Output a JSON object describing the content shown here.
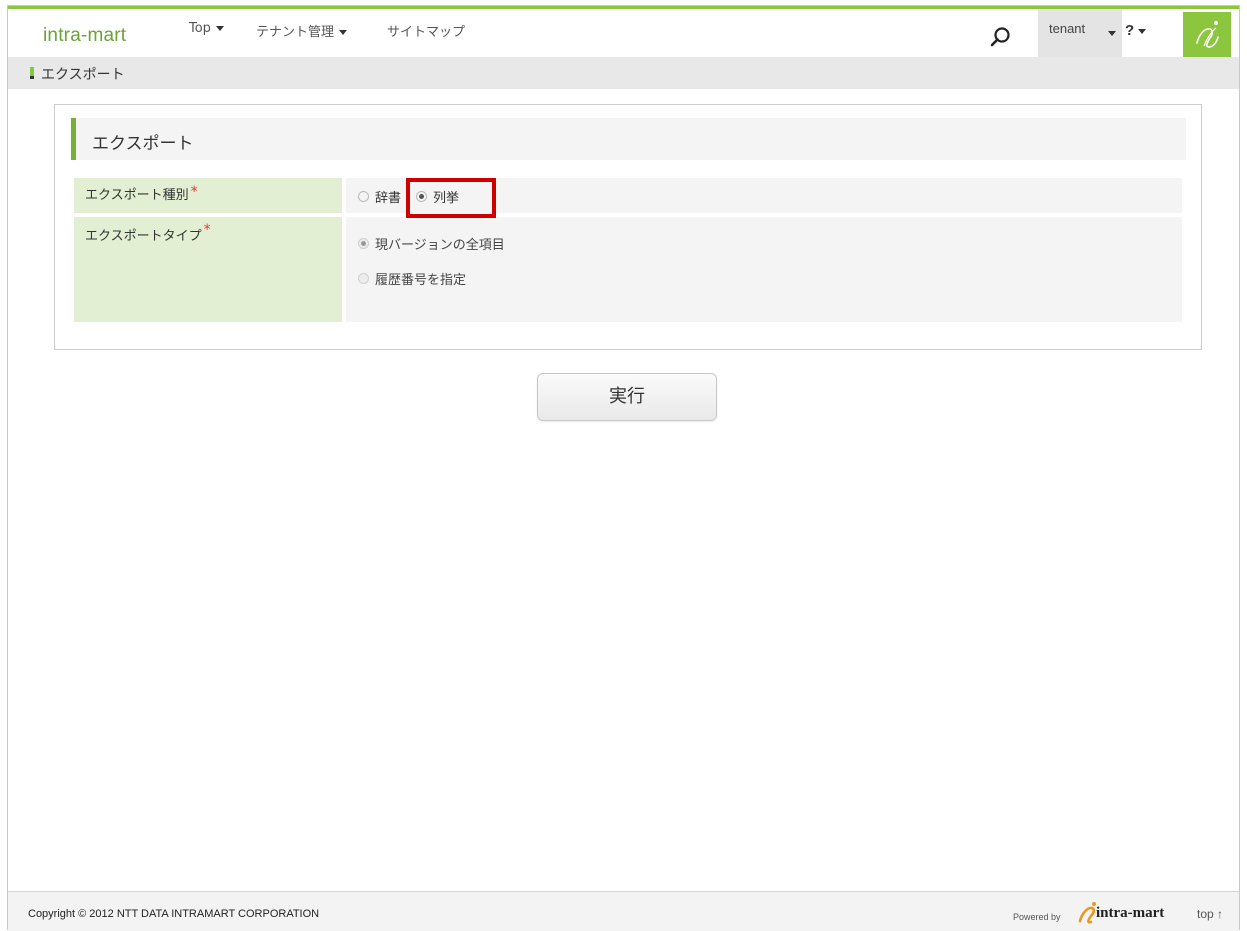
{
  "header": {
    "brand": "intra-mart",
    "nav": [
      {
        "label": "Top"
      },
      {
        "label": "テナント管理"
      },
      {
        "label": "サイトマップ"
      }
    ],
    "user": "tenant",
    "help": "?"
  },
  "breadcrumb": "エクスポート",
  "section": {
    "title": "エクスポート"
  },
  "form": {
    "export_kind": {
      "label": "エクスポート種別",
      "required_mark": "*",
      "options": [
        "辞書",
        "列挙"
      ],
      "selected": "列挙"
    },
    "export_type": {
      "label": "エクスポートタイプ",
      "required_mark": "*",
      "options": [
        "現バージョンの全項目",
        "履歴番号を指定"
      ],
      "selected": "現バージョンの全項目"
    }
  },
  "execute_label": "実行",
  "footer": {
    "copyright": "Copyright © 2012 NTT DATA INTRAMART CORPORATION",
    "powered_by": "Powered by",
    "powered_logo": "intra-mart",
    "top_link": "top ↑"
  },
  "colors": {
    "accent": "#8cc63f",
    "label_bg": "#e2efd2",
    "highlight": "#cc0000",
    "required": "#ee3333"
  },
  "icons": {
    "search": "search-icon",
    "logo": "intra-mart-i-logo-icon",
    "caret": "caret-down-icon",
    "radio": "radio-icon"
  }
}
